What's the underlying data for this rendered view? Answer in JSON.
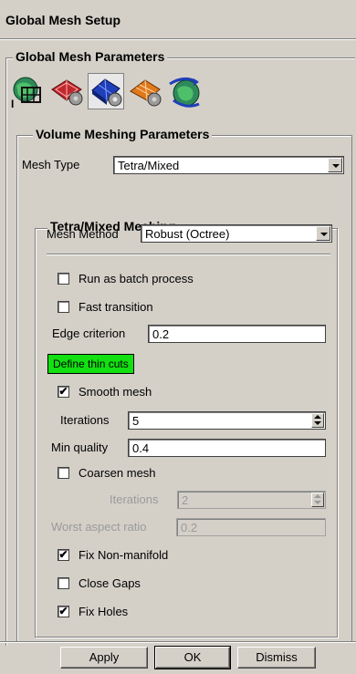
{
  "window": {
    "title": "Global Mesh Setup"
  },
  "global_params": {
    "legend": "Global Mesh Parameters",
    "icons": [
      {
        "name": "global-size-icon",
        "marker": "I"
      },
      {
        "name": "shell-meshing-icon"
      },
      {
        "name": "volume-meshing-icon",
        "selected": true
      },
      {
        "name": "prism-meshing-icon"
      },
      {
        "name": "periodicity-icon"
      }
    ]
  },
  "volume": {
    "legend": "Volume Meshing Parameters",
    "mesh_type_label": "Mesh Type",
    "mesh_type_value": "Tetra/Mixed"
  },
  "tetra": {
    "legend": "Tetra/Mixed Meshing",
    "mesh_method_label": "Mesh Method",
    "mesh_method_value": "Robust (Octree)",
    "run_batch_label": "Run as batch process",
    "fast_transition_label": "Fast transition",
    "edge_criterion_label": "Edge criterion",
    "edge_criterion_value": "0.2",
    "define_thin_cuts_label": "Define thin cuts",
    "smooth_mesh_label": "Smooth mesh",
    "iterations_label": "Iterations",
    "iterations_value": "5",
    "min_quality_label": "Min quality",
    "min_quality_value": "0.4",
    "coarsen_mesh_label": "Coarsen mesh",
    "coarsen_iterations_label": "Iterations",
    "coarsen_iterations_value": "2",
    "worst_aspect_label": "Worst aspect ratio",
    "worst_aspect_value": "0.2",
    "fix_nonmanifold_label": "Fix Non-manifold",
    "close_gaps_label": "Close Gaps",
    "fix_holes_label": "Fix Holes",
    "checks": {
      "run_batch": "",
      "fast_transition": "",
      "smooth_mesh": "✔",
      "coarsen_mesh": "",
      "fix_nonmanifold": "✔",
      "close_gaps": "",
      "fix_holes": "✔"
    }
  },
  "buttons": {
    "apply": "Apply",
    "ok": "OK",
    "dismiss": "Dismiss"
  },
  "colors": {
    "panel": "#d4d0c8",
    "thin_cuts_button": "#12e012"
  }
}
